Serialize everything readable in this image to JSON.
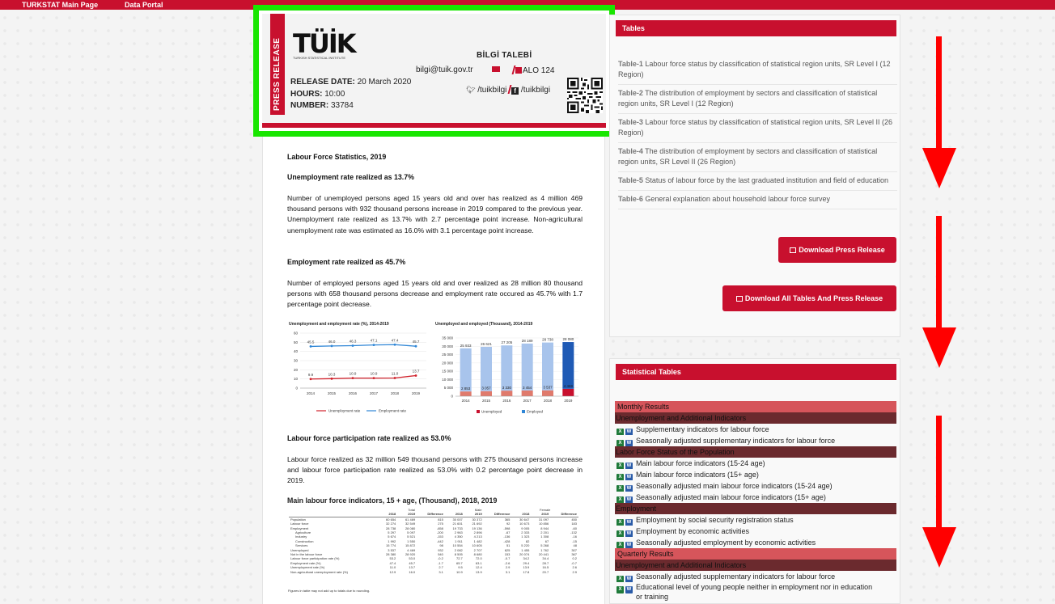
{
  "topnav": {
    "main": "TURKSTAT Main Page",
    "portal": "Data Portal"
  },
  "press": {
    "ribbon": "PRESS RELEASE",
    "logo_text": "TÜİK",
    "logo_sub": "TURKISH STATISTICAL INSTITUTE",
    "release_date_label": "RELEASE DATE:",
    "release_date": "20 March 2020",
    "hours_label": "HOURS:",
    "hours": "10:00",
    "number_label": "NUMBER:",
    "number": "33784",
    "bilgi_title": "BİLGİ TALEBİ",
    "email": "bilgi@tuik.gov.tr",
    "alo": "ALO 124",
    "twitter": "/tuikbilgi",
    "facebook": "/tuikbilgi"
  },
  "article": {
    "heading": "Labour Force Statistics, 2019",
    "h1": "Unemployment rate realized as 13.7%",
    "p1": "Number of unemployed persons aged 15 years old and over has realized as 4 million 469 thousand persons with 932 thousand persons increase in 2019 compared to the previous year. Unemployment rate realized as 13.7% with 2.7 percentage point increase. Non-agricultural unemployment rate was estimated as 16.0% with 3.1 percentage point increase.",
    "h2": "Employment rate realized as 45.7%",
    "p2": "Number of employed persons aged 15 years old and over realized as 28 million 80 thousand persons with 658 thousand persons decrease and employment rate occured as 45.7% with 1.7 percentage point decrease.",
    "h3": "Labour force participation rate realized as 53.0%",
    "p3": "Labour force realized as 32 million 549 thousand persons with 275 thousand persons increase and labour force participation rate realized as 53.0% with 0.2 percentage point decrease in 2019.",
    "table_title": "Main labour force indicators, 15 + age, (Thousand), 2018, 2019",
    "table_foot": "Figures in table may not add up to totals due to rounding."
  },
  "mini_table": {
    "groups": [
      "Total",
      "Male",
      "Female"
    ],
    "sub": [
      "2018",
      "2019",
      "Difference"
    ],
    "rows": [
      [
        "Population",
        "60 654",
        "61 469",
        "815",
        "30 007",
        "30 372",
        "365",
        "30 647",
        "31 097",
        "450"
      ],
      [
        "Labour force",
        "32 274",
        "32 549",
        "275",
        "21 601",
        "21 692",
        "92",
        "10 673",
        "10 856",
        "183"
      ],
      [
        "Employment",
        "28 738",
        "28 080",
        "-658",
        "19 733",
        "19 136",
        "-598",
        "9 005",
        "8 944",
        "-60"
      ],
      [
        "Agriculture",
        "5 297",
        "5 097",
        "-200",
        "2 963",
        "2 896",
        "-67",
        "2 333",
        "2 201",
        "-132"
      ],
      [
        "Industry",
        "5 674",
        "5 521",
        "-153",
        "4 350",
        "4 213",
        "-136",
        "1 323",
        "1 308",
        "-16"
      ],
      [
        "Construction",
        "1 992",
        "1 550",
        "-442",
        "1 911",
        "1 482",
        "-428",
        "82",
        "67",
        "-15"
      ],
      [
        "Services",
        "15 774",
        "15 872",
        "98",
        "10 554",
        "10 605",
        "51",
        "5 220",
        "5 268",
        "48"
      ],
      [
        "Unemployed",
        "3 537",
        "4 469",
        "932",
        "2 082",
        "2 707",
        "625",
        "1 455",
        "1 762",
        "307"
      ],
      [
        "Not in the labour force",
        "28 380",
        "28 920",
        "540",
        "8 505",
        "8 680",
        "153",
        "20 074",
        "20 441",
        "367"
      ],
      [
        "Labour force participation rate (%)",
        "53.2",
        "53.0",
        "-0.2",
        "72.7",
        "72.0",
        "-0.7",
        "34.2",
        "34.4",
        "0.2"
      ],
      [
        "Employment rate (%)",
        "47.4",
        "45.7",
        "-1.7",
        "65.7",
        "63.1",
        "-2.6",
        "29.4",
        "28.7",
        "-0.7"
      ],
      [
        "Unemployment rate (%)",
        "11.0",
        "13.7",
        "2.7",
        "9.5",
        "12.4",
        "2.9",
        "13.9",
        "16.5",
        "2.6"
      ],
      [
        "Non-agricultural unemployment rate (%)",
        "12.9",
        "16.0",
        "3.1",
        "10.9",
        "13.9",
        "3.1",
        "17.8",
        "20.7",
        "2.9"
      ]
    ]
  },
  "tables_panel": {
    "title": "Tables",
    "items": [
      {
        "code": "Table-1",
        "text": " Labour force status by classification of statistical region units, SR Level I (12 Region)"
      },
      {
        "code": "Table-2",
        "text": " The distribution of employment by sectors and classification of statistical region units, SR Level I (12 Region)"
      },
      {
        "code": "Table-3",
        "text": " Labour force status by classification of statistical region units, SR Level II (26 Region)"
      },
      {
        "code": "Table-4",
        "text": " The distribution of employment by sectors and classification of statistical region units, SR Level II (26 Region)"
      },
      {
        "code": "Table-5",
        "text": " Status of labour force by the last graduated institution and field of education"
      },
      {
        "code": "Table-6",
        "text": " General explanation about household labour force survey"
      }
    ],
    "download_press": "Download Press Release",
    "download_all": "Download All Tables And Press Release"
  },
  "stat_panel": {
    "title": "Statistical Tables",
    "monthly": "Monthly Results",
    "g1": "Unemployment and Additional Indicators",
    "g1_items": [
      "Supplementary indicators for labour force",
      "Seasonally adjusted supplementary indicators for labour force"
    ],
    "g2": "Labor Force Status of the Population",
    "g2_items": [
      "Main labour force indicators (15-24 age)",
      "Main labour force indicators (15+ age)",
      "Seasonally adjusted main labour force indicators (15-24 age)",
      "Seasonally adjusted main labour force indicators (15+ age)"
    ],
    "g3": "Employment",
    "g3_items": [
      "Employment by social security registration status",
      "Employment by economic activities",
      "Seasonally adjusted employment by economic activities"
    ],
    "quarterly": "Quarterly Results",
    "g4": "Unemployment and Additional Indicators",
    "g4_items": [
      "Seasonally adjusted supplementary indicators for labour force",
      "Educational level of young people neither in employment nor in education or training"
    ],
    "xls": "X",
    "doc": "W"
  },
  "colors": {
    "accent": "#c8102e",
    "highlight": "#18e600",
    "arrow": "#ff0000"
  },
  "chart_data": [
    {
      "type": "line",
      "title": "Unemployment and employment rate (%), 2014-2019",
      "x": [
        "2014",
        "2015",
        "2016",
        "2017",
        "2018",
        "2019"
      ],
      "ylim": [
        0,
        60
      ],
      "yticks": [
        "0",
        "10",
        "20",
        "30",
        "40",
        "50",
        "60"
      ],
      "series": [
        {
          "name": "Unemployment rate",
          "values": [
            9.9,
            10.3,
            10.9,
            10.9,
            11.0,
            13.7
          ],
          "labels": [
            "9.9",
            "10.3",
            "10.9",
            "10.9",
            "11.0",
            "13.7"
          ],
          "color": "#d0202a"
        },
        {
          "name": "Employment rate",
          "values": [
            45.5,
            46.0,
            46.3,
            47.1,
            47.4,
            45.7
          ],
          "labels": [
            "45.5",
            "46.0",
            "46.3",
            "47.1",
            "47.4",
            "45.7"
          ],
          "color": "#2f86d6"
        }
      ],
      "legend": "bottom"
    },
    {
      "type": "bar",
      "title": "Unemployed and employed (Thousand), 2014-2019",
      "categories": [
        "2014",
        "2015",
        "2016",
        "2017",
        "2018",
        "2019"
      ],
      "ylim": [
        0,
        35000
      ],
      "yticks": [
        "0",
        "5 000",
        "10 000",
        "15 000",
        "20 000",
        "25 000",
        "30 000",
        "35 000"
      ],
      "series": [
        {
          "name": "Unemployed",
          "values": [
            2853,
            3057,
            3330,
            3454,
            3537,
            4469
          ],
          "labels": [
            "2 853",
            "3 057",
            "3 330",
            "3 454",
            "3 537",
            "4 469"
          ],
          "color": "#e07a6c"
        },
        {
          "name": "Employed",
          "values": [
            25933,
            26621,
            27205,
            28189,
            28738,
            28080
          ],
          "labels": [
            "25 933",
            "26 621",
            "27 205",
            "28 189",
            "28 738",
            "28 080"
          ],
          "color": "#a8c4ec"
        }
      ],
      "legend": "bottom"
    }
  ]
}
